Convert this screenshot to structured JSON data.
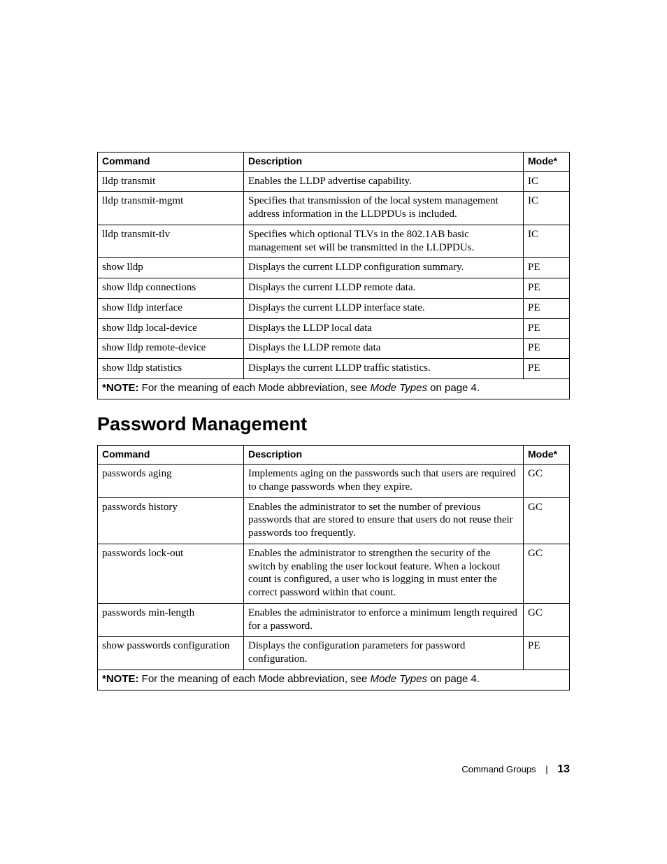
{
  "table1": {
    "headers": {
      "command": "Command",
      "description": "Description",
      "mode": "Mode*"
    },
    "rows": [
      {
        "command": "lldp transmit",
        "description": "Enables the LLDP advertise capability.",
        "mode": "IC"
      },
      {
        "command": "lldp transmit-mgmt",
        "description": "Specifies that transmission of the local system management address information in the LLDPDUs is included.",
        "mode": "IC"
      },
      {
        "command": "lldp transmit-tlv",
        "description": "Specifies which optional TLVs in the 802.1AB basic management set will be transmitted in the LLDPDUs.",
        "mode": "IC"
      },
      {
        "command": "show lldp",
        "description": "Displays the current LLDP configuration summary.",
        "mode": "PE"
      },
      {
        "command": "show lldp connections",
        "description": "Displays the current LLDP remote data.",
        "mode": "PE"
      },
      {
        "command": "show lldp interface",
        "description": "Displays the current LLDP interface state.",
        "mode": "PE"
      },
      {
        "command": "show lldp local-device",
        "description": "Displays the LLDP local data",
        "mode": "PE"
      },
      {
        "command": "show lldp remote-device",
        "description": "Displays the LLDP remote data",
        "mode": "PE"
      },
      {
        "command": "show lldp statistics",
        "description": "Displays the current LLDP traffic statistics.",
        "mode": "PE"
      }
    ],
    "note": {
      "prefix": "*NOTE:",
      "body_before_link": " For the meaning of each Mode abbreviation, see ",
      "link": "Mode Types",
      "body_after_link": " on page 4."
    }
  },
  "section_heading": "Password Management",
  "table2": {
    "headers": {
      "command": "Command",
      "description": "Description",
      "mode": "Mode*"
    },
    "rows": [
      {
        "command": "passwords aging",
        "description": "Implements aging on the passwords such that users are required to change passwords when they expire.",
        "mode": "GC"
      },
      {
        "command": "passwords history",
        "description": "Enables the administrator to set the number of previous passwords that are stored to ensure that users do not reuse their passwords too frequently.",
        "mode": "GC"
      },
      {
        "command": "passwords lock-out",
        "description": "Enables the administrator to strengthen the security of the switch by enabling the user lockout feature. When a lockout count is configured, a user who is logging in must enter the correct password within that count.",
        "mode": "GC"
      },
      {
        "command": "passwords min-length",
        "description": "Enables the administrator to enforce a minimum length required for a password.",
        "mode": "GC"
      },
      {
        "command": "show passwords configuration",
        "description": "Displays the configuration parameters for password configuration.",
        "mode": "PE"
      }
    ],
    "note": {
      "prefix": "*NOTE:",
      "body_before_link": " For the meaning of each Mode abbreviation, see ",
      "link": "Mode Types",
      "body_after_link": " on page 4."
    }
  },
  "footer": {
    "label": "Command Groups",
    "page": "13"
  }
}
